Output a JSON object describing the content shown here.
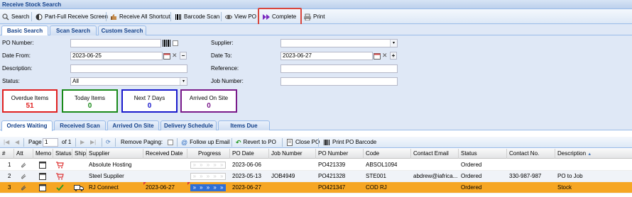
{
  "window_title": "Receive Stock Search",
  "toolbar": {
    "search": "Search",
    "part_full": "Part-Full Receive Screen",
    "receive_all": "Receive All Shortcut",
    "barcode": "Barcode Scan",
    "view_po": "View PO",
    "complete": "Complete",
    "print": "Print"
  },
  "search_tabs": [
    "Basic Search",
    "Scan Search",
    "Custom Search"
  ],
  "form": {
    "po_number_label": "PO Number:",
    "po_number_value": "",
    "supplier_label": "Supplier:",
    "supplier_value": "",
    "date_from_label": "Date From:",
    "date_from_value": "2023-06-25",
    "date_to_label": "Date To:",
    "date_to_value": "2023-06-27",
    "description_label": "Description:",
    "description_value": "",
    "reference_label": "Reference:",
    "reference_value": "",
    "status_label": "Status:",
    "status_value": "All",
    "job_number_label": "Job Number:",
    "job_number_value": ""
  },
  "summary": [
    {
      "label": "Overdue Items",
      "value": "51",
      "color": "#e02020"
    },
    {
      "label": "Today Items",
      "value": "0",
      "color": "#1a8a1a"
    },
    {
      "label": "Next 7 Days",
      "value": "0",
      "color": "#1a1acc"
    },
    {
      "label": "Arrived On Site",
      "value": "0",
      "color": "#7a1a8a"
    }
  ],
  "grid_tabs": [
    "Orders Waiting",
    "Received Scan",
    "Arrived On Site",
    "Delivery Schedule",
    "Items Due"
  ],
  "paging": {
    "page_label": "Page",
    "page_value": "1",
    "of_label": "of 1",
    "remove_paging": "Remove Paging:",
    "follow_up": "Follow up Email",
    "revert": "Revert to PO",
    "close_po": "Close PO",
    "print_barcode": "Print PO Barcode"
  },
  "columns": [
    "#",
    "Att",
    "Memo",
    "Status",
    "Ship",
    "Supplier",
    "Received Date",
    "Progress",
    "PO Date",
    "Job Number",
    "PO Number",
    "Code",
    "Contact Email",
    "Status",
    "Contact No.",
    "Description"
  ],
  "rows": [
    {
      "num": "1",
      "supplier": "Absolute Hosting",
      "received_date": "",
      "po_date": "2023-06-06",
      "job_number": "",
      "po_number": "PO421339",
      "code": "ABSOL1094",
      "email": "",
      "status": "Ordered",
      "contact_no": "",
      "description": ""
    },
    {
      "num": "2",
      "supplier": "Steel Supplier",
      "received_date": "",
      "po_date": "2023-05-13",
      "job_number": "JOB4949",
      "po_number": "PO421328",
      "code": "STE001",
      "email": "abdrew@iafrica...",
      "status": "Ordered",
      "contact_no": "330-987-987",
      "description": "PO to Job"
    },
    {
      "num": "3",
      "supplier": "RJ Connect",
      "received_date": "2023-06-27",
      "po_date": "2023-06-27",
      "job_number": "",
      "po_number": "PO421347",
      "code": "COD RJ",
      "email": "",
      "status": "Ordered",
      "contact_no": "",
      "description": "Stock"
    }
  ]
}
